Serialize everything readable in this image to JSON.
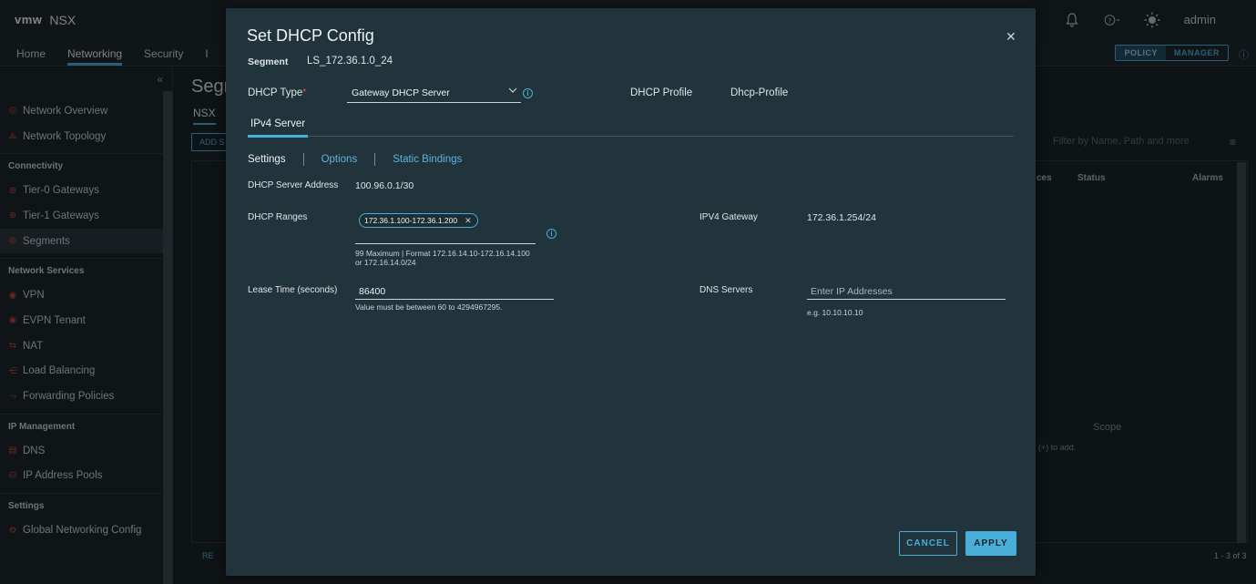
{
  "app": {
    "logo": "vmw",
    "name": "NSX",
    "user": "admin"
  },
  "topbar_icons": [
    "bell-icon",
    "help-icon",
    "theme-icon"
  ],
  "nav": {
    "tabs": [
      "Home",
      "Networking",
      "Security",
      "I"
    ],
    "active": "Networking",
    "modes": [
      "POLICY",
      "MANAGER"
    ],
    "active_mode": "POLICY"
  },
  "sidebar": {
    "top_items": [
      {
        "label": "Network Overview",
        "icon": "network-overview-icon"
      },
      {
        "label": "Network Topology",
        "icon": "network-topology-icon"
      }
    ],
    "sections": [
      {
        "title": "Connectivity",
        "items": [
          "Tier-0 Gateways",
          "Tier-1 Gateways",
          "Segments"
        ]
      },
      {
        "title": "Network Services",
        "items": [
          "VPN",
          "EVPN Tenant",
          "NAT",
          "Load Balancing",
          "Forwarding Policies"
        ]
      },
      {
        "title": "IP Management",
        "items": [
          "DNS",
          "IP Address Pools"
        ]
      },
      {
        "title": "Settings",
        "items": [
          "Global Networking Config"
        ]
      }
    ],
    "active": "Segments"
  },
  "background": {
    "title": "Segm",
    "subtab": "NSX",
    "add_button": "ADD S",
    "filter_placeholder": "Filter by Name, Path and more",
    "columns": [
      "ces",
      "Status",
      "Alarms"
    ],
    "scope_label": "Scope",
    "add_hint": "(+) to add.",
    "refresh": "RE",
    "count": "1 - 3 of 3"
  },
  "modal": {
    "title": "Set DHCP Config",
    "segment_label": "Segment",
    "segment_value": "LS_172.36.1.0_24",
    "dhcp_type_label": "DHCP Type",
    "dhcp_type_required": "*",
    "dhcp_type_value": "Gateway DHCP Server",
    "dhcp_profile_label": "DHCP Profile",
    "dhcp_profile_value": "Dhcp-Profile",
    "server_tab": "IPv4 Server",
    "sub_tabs": {
      "settings": "Settings",
      "options": "Options",
      "static_bindings": "Static Bindings"
    },
    "server_address_label": "DHCP Server Address",
    "server_address_value": "100.96.0.1/30",
    "ranges_label": "DHCP Ranges",
    "range_chip": "172.36.1.100-172.36.1.200",
    "ranges_hint": "99 Maximum | Format 172.16.14.10-172.16.14.100 or 172.16.14.0/24",
    "gateway_label": "IPV4 Gateway",
    "gateway_value": "172.36.1.254/24",
    "lease_label": "Lease Time (seconds)",
    "lease_value": "86400",
    "lease_hint": "Value must be between 60 to 4294967295.",
    "dns_label": "DNS Servers",
    "dns_placeholder": "Enter IP Addresses",
    "dns_hint": "e.g. 10.10.10.10",
    "cancel": "CANCEL",
    "apply": "APPLY"
  }
}
